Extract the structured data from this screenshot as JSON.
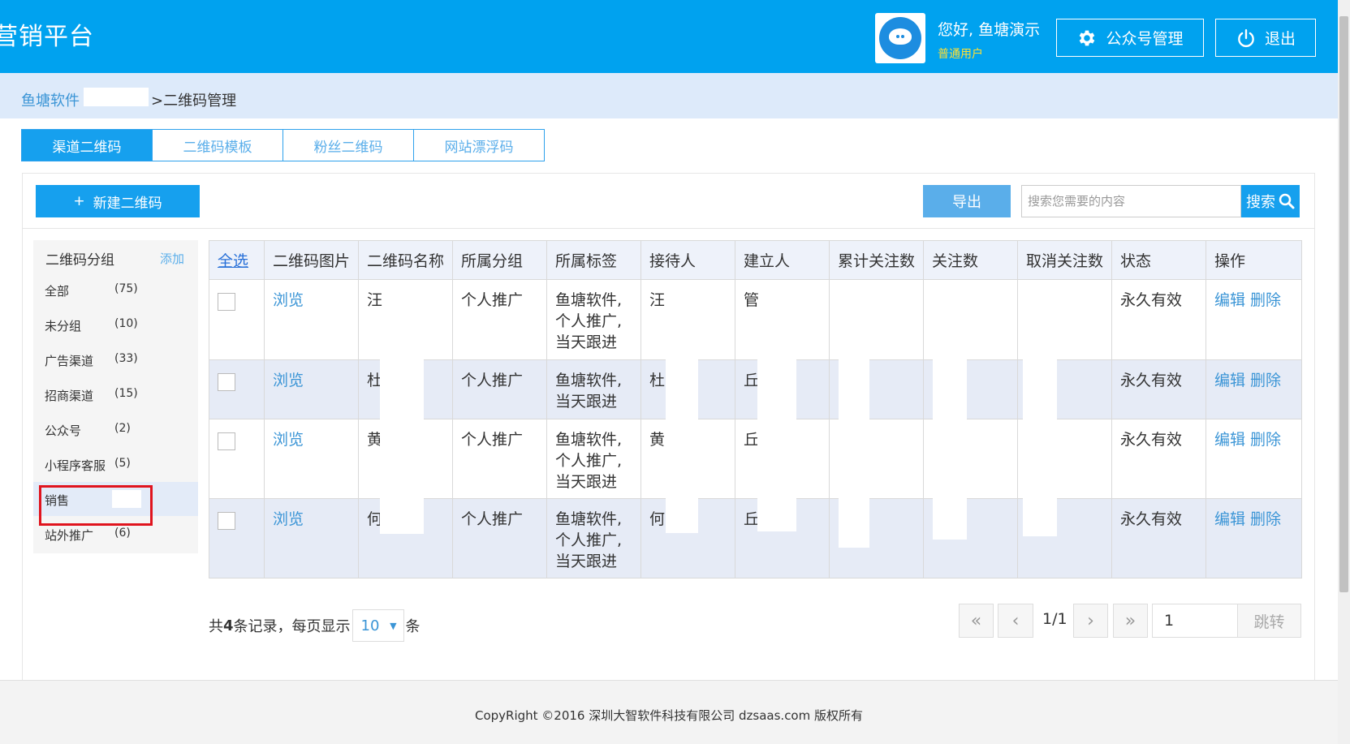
{
  "header": {
    "app_title": "营销平台",
    "greeting": "您好, 鱼塘演示",
    "role": "普通用户",
    "mp_button": "公众号管理",
    "logout_button": "退出"
  },
  "breadcrumb": {
    "home": "鱼塘软件",
    "current": ">二维码管理"
  },
  "tabs": [
    {
      "label": "渠道二维码",
      "active": true
    },
    {
      "label": "二维码模板"
    },
    {
      "label": "粉丝二维码"
    },
    {
      "label": "网站漂浮码"
    }
  ],
  "toolbar": {
    "new_button": "新建二维码",
    "export_button": "导出",
    "search_placeholder": "搜索您需要的内容",
    "search_button": "搜索"
  },
  "groups": {
    "title": "二维码分组",
    "add_label": "添加",
    "items": [
      {
        "name": "全部",
        "count": "(75)"
      },
      {
        "name": "未分组",
        "count": "(10)"
      },
      {
        "name": "广告渠道",
        "count": "(33)"
      },
      {
        "name": "招商渠道",
        "count": "(15)"
      },
      {
        "name": "公众号",
        "count": "(2)"
      },
      {
        "name": "小程序客服",
        "count": "(5)"
      },
      {
        "name": "销售",
        "count": ""
      },
      {
        "name": "站外推广",
        "count": "(6)"
      }
    ]
  },
  "table": {
    "select_all": "全选",
    "columns": [
      "二维码图片",
      "二维码名称",
      "所属分组",
      "所属标签",
      "接待人",
      "建立人",
      "累计关注数",
      "关注数",
      "取消关注数",
      "状态",
      "操作"
    ],
    "rows": [
      {
        "image": "浏览",
        "name": "汪",
        "group": "个人推广",
        "tags": [
          "鱼塘软件,",
          "个人推广,",
          "当天跟进"
        ],
        "receiver": "汪",
        "creator": "管",
        "total": "",
        "follow": "",
        "unfollow": "",
        "status": "永久有效",
        "edit": "编辑",
        "delete": "删除"
      },
      {
        "image": "浏览",
        "name": "杜",
        "group": "个人推广",
        "tags": [
          "鱼塘软件,",
          "当天跟进"
        ],
        "receiver": "杜",
        "creator": "丘",
        "total": "",
        "follow": "",
        "unfollow": "",
        "status": "永久有效",
        "edit": "编辑",
        "delete": "删除"
      },
      {
        "image": "浏览",
        "name": "黄",
        "group": "个人推广",
        "tags": [
          "鱼塘软件,",
          "个人推广,",
          "当天跟进"
        ],
        "receiver": "黄",
        "creator": "丘",
        "total": "",
        "follow": "",
        "unfollow": "",
        "status": "永久有效",
        "edit": "编辑",
        "delete": "删除"
      },
      {
        "image": "浏览",
        "name": "何",
        "group": "个人推广",
        "tags": [
          "鱼塘软件,",
          "个人推广,",
          "当天跟进"
        ],
        "receiver": "何",
        "creator": "丘",
        "total": "",
        "follow": "",
        "unfollow": "",
        "status": "永久有效",
        "edit": "编辑",
        "delete": "删除"
      }
    ]
  },
  "pagination": {
    "total_prefix": "共",
    "total_count": "4",
    "total_suffix": "条记录，每页显示",
    "page_size": "10",
    "unit": "条",
    "page_info": "1/1",
    "jump_value": "1",
    "jump_button": "跳转"
  },
  "footer": {
    "copyright": "CopyRight ©2016 深圳大智软件科技有限公司 dzsaas.com 版权所有"
  },
  "colors": {
    "brand": "#00a2ef",
    "tab_active": "#16a0ee",
    "link": "#3b95d6",
    "highlight": "#e0141e",
    "role": "#ffe033"
  }
}
